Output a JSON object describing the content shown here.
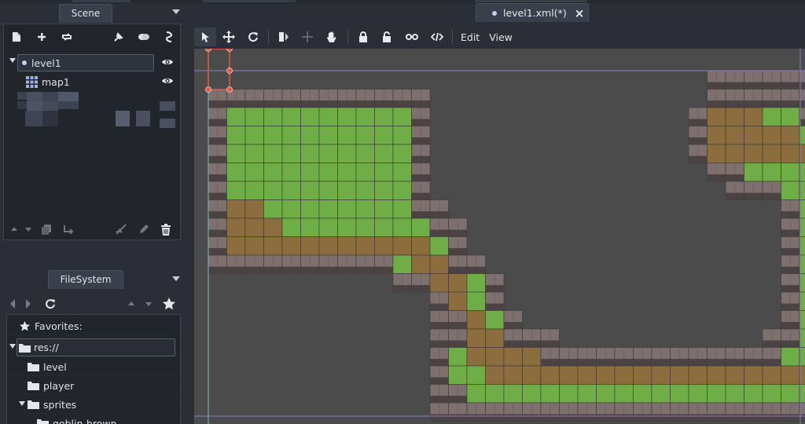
{
  "scene_dock": {
    "tab_label": "Scene",
    "toolbar_icons": [
      "new-scene-icon",
      "add-node-icon",
      "replace-node-icon",
      "instance-icon",
      "groups-icon",
      "script-icon"
    ],
    "nodes": [
      {
        "label": "level1",
        "icon": "node-dot-icon",
        "visible_icon": "eye-icon",
        "selected": true
      },
      {
        "label": "map1",
        "icon": "tilemap-icon",
        "visible_icon": "eye-icon",
        "selected": false
      }
    ],
    "bottom_icons": [
      "move-up-icon",
      "move-down-icon",
      "duplicate-icon",
      "reparent-icon",
      "merge-icon",
      "edit-icon",
      "delete-icon"
    ]
  },
  "filesystem_dock": {
    "tab_label": "FileSystem",
    "nav_icons": [
      "back-icon",
      "forward-icon",
      "refresh-icon",
      "move-up-icon",
      "move-down-icon",
      "favorite-star-icon"
    ],
    "items": [
      {
        "label": "Favorites:",
        "icon": "star-icon",
        "level": 0,
        "expanded": false
      },
      {
        "label": "res://",
        "icon": "folder-icon",
        "level": 0,
        "expanded": true,
        "selected": true
      },
      {
        "label": "level",
        "icon": "folder-icon",
        "level": 1
      },
      {
        "label": "player",
        "icon": "folder-icon",
        "level": 1
      },
      {
        "label": "sprites",
        "icon": "folder-icon",
        "level": 1,
        "expanded": true
      },
      {
        "label": "goblin-brown",
        "icon": "folder-icon",
        "level": 2
      }
    ]
  },
  "editor": {
    "tab_label": "level1.xml(*)",
    "tab_close": "×",
    "menus": [
      "Edit",
      "View"
    ],
    "tools": [
      "select-icon",
      "move-icon",
      "rotate-icon",
      "pivot-icon",
      "pivot-disabled-icon",
      "pan-hand-icon",
      "lock-icon",
      "unlock-icon",
      "group-icon",
      "ungroup-icon"
    ]
  },
  "colors": {
    "grass": "#6fae47",
    "dirt": "#8c6e3e",
    "stone": "#7f7070",
    "void": "#4b4b4c",
    "selection": "#e8594a",
    "accent": "#8fa7e8"
  }
}
